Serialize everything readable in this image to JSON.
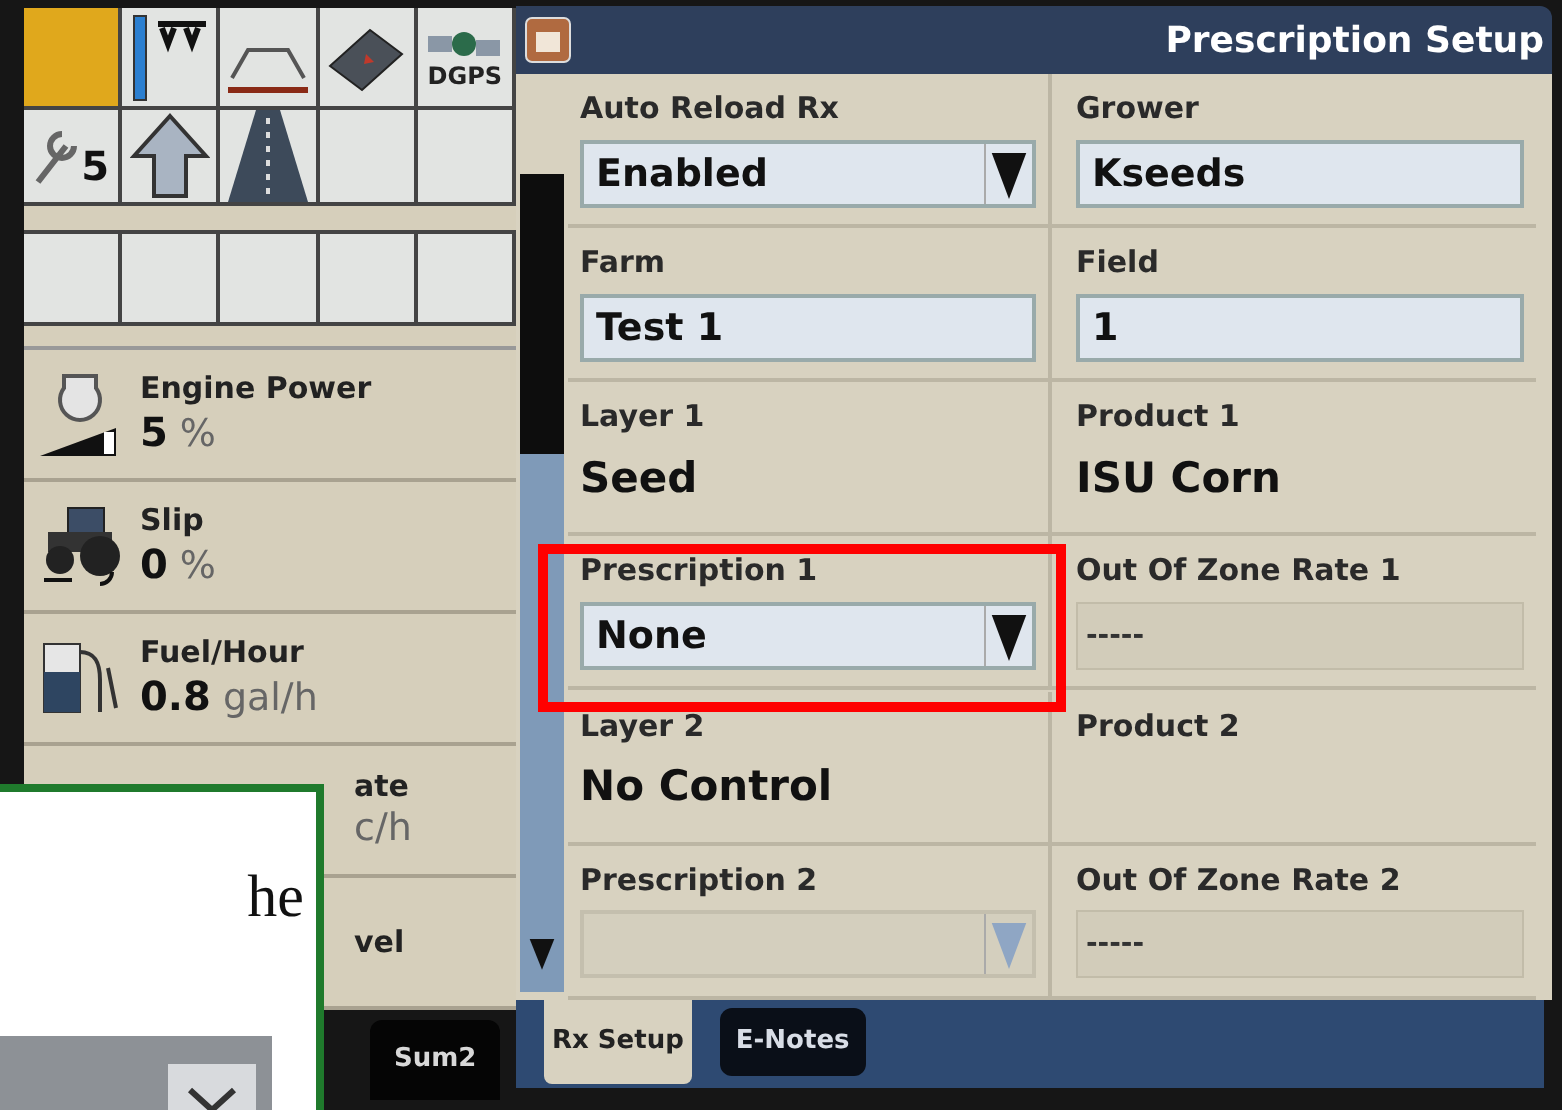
{
  "status_icons": {
    "gps_label": "DGPS",
    "wrench_count": "5"
  },
  "readouts": [
    {
      "kind": "engine",
      "label": "Engine Power",
      "value": "5",
      "unit": "%"
    },
    {
      "kind": "slip",
      "label": "Slip",
      "value": "0",
      "unit": "%"
    },
    {
      "kind": "fuel",
      "label": "Fuel/Hour",
      "value": "0.8",
      "unit": "gal/h"
    },
    {
      "kind": "covered",
      "label": "ate",
      "unit": "c/h"
    },
    {
      "kind": "covered",
      "label": "vel"
    }
  ],
  "left_tabs": [
    {
      "label": "Sum2",
      "selected": false
    }
  ],
  "window": {
    "title": "Prescription Setup"
  },
  "fields": [
    {
      "kind": "dropdown",
      "label": "Auto Reload Rx",
      "value": "Enabled",
      "disabled": false
    },
    {
      "kind": "text_field",
      "label": "Grower",
      "value": "Kseeds"
    },
    {
      "kind": "text_field",
      "label": "Farm",
      "value": "Test 1"
    },
    {
      "kind": "text_field",
      "label": "Field",
      "value": "1"
    },
    {
      "kind": "text",
      "label": "Layer 1",
      "value": "Seed"
    },
    {
      "kind": "text",
      "label": "Product 1",
      "value": "ISU Corn"
    },
    {
      "kind": "dropdown",
      "label": "Prescription 1",
      "value": "None",
      "disabled": false
    },
    {
      "kind": "readonly",
      "label": "Out Of Zone Rate 1",
      "value": "-----"
    },
    {
      "kind": "text",
      "label": "Layer 2",
      "value": "No Control"
    },
    {
      "kind": "text",
      "label": "Product 2"
    },
    {
      "kind": "dropdown",
      "label": "Prescription 2",
      "disabled": true
    },
    {
      "kind": "readonly",
      "label": "Out Of Zone Rate 2",
      "value": "-----"
    }
  ],
  "tabs": [
    {
      "label": "Rx Setup",
      "selected": true
    },
    {
      "label": "E-Notes",
      "selected": false
    }
  ],
  "overlay": {
    "text": "he"
  }
}
